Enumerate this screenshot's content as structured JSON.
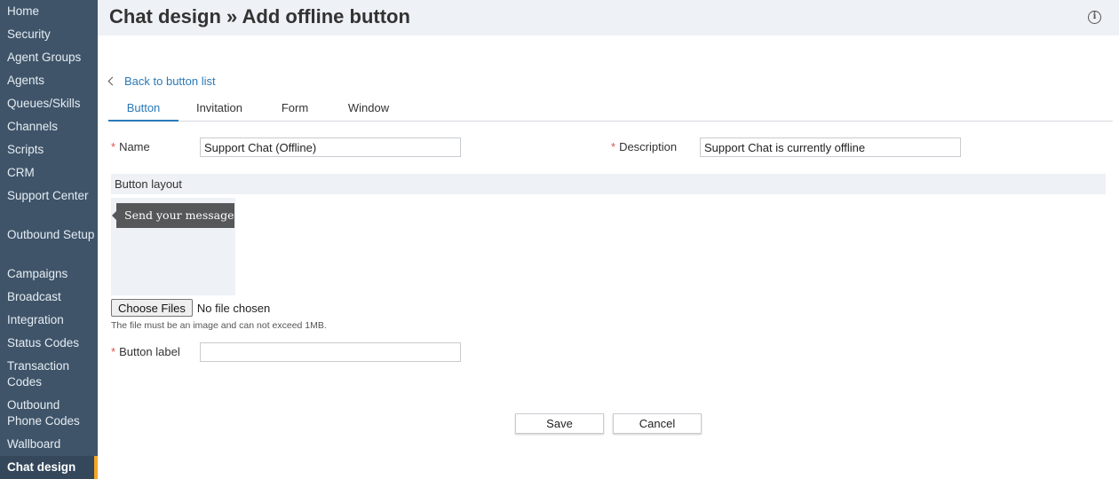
{
  "sidebar": {
    "items": [
      {
        "label": "Home"
      },
      {
        "label": "Security"
      },
      {
        "label": "Agent Groups"
      },
      {
        "label": "Agents"
      },
      {
        "label": "Queues/Skills"
      },
      {
        "label": "Channels"
      },
      {
        "label": "Scripts"
      },
      {
        "label": "CRM"
      },
      {
        "label": "Support Center"
      },
      {
        "label": "Outbound Setup"
      },
      {
        "label": "Campaigns"
      },
      {
        "label": "Broadcast"
      },
      {
        "label": "Integration"
      },
      {
        "label": "Status Codes"
      },
      {
        "label": "Transaction Codes"
      },
      {
        "label": "Outbound Phone Codes"
      },
      {
        "label": "Wallboard"
      },
      {
        "label": "Chat design"
      }
    ],
    "active": "Chat design"
  },
  "header": {
    "title": "Chat design » Add offline button",
    "info_icon": "info-icon"
  },
  "main": {
    "back_link": "Back to button list",
    "tabs": [
      {
        "label": "Button"
      },
      {
        "label": "Invitation"
      },
      {
        "label": "Form"
      },
      {
        "label": "Window"
      }
    ],
    "active_tab": "Button",
    "required_mark": "*",
    "name": {
      "label": "Name",
      "value": "Support Chat (Offline)"
    },
    "description": {
      "label": "Description",
      "value": "Support Chat is currently offline"
    },
    "layout": {
      "title": "Button layout",
      "preview_text": "Send your message"
    },
    "file": {
      "button_label": "Choose Files",
      "status": "No file chosen",
      "hint": "The file must be an image and can not exceed 1MB."
    },
    "button_label_field": {
      "label": "Button label",
      "value": ""
    },
    "actions": {
      "save": "Save",
      "cancel": "Cancel"
    }
  },
  "colors": {
    "sidebar_bg": "#3f5469",
    "accent": "#f5a623",
    "link": "#2a7ab8",
    "required": "#d9534f"
  }
}
